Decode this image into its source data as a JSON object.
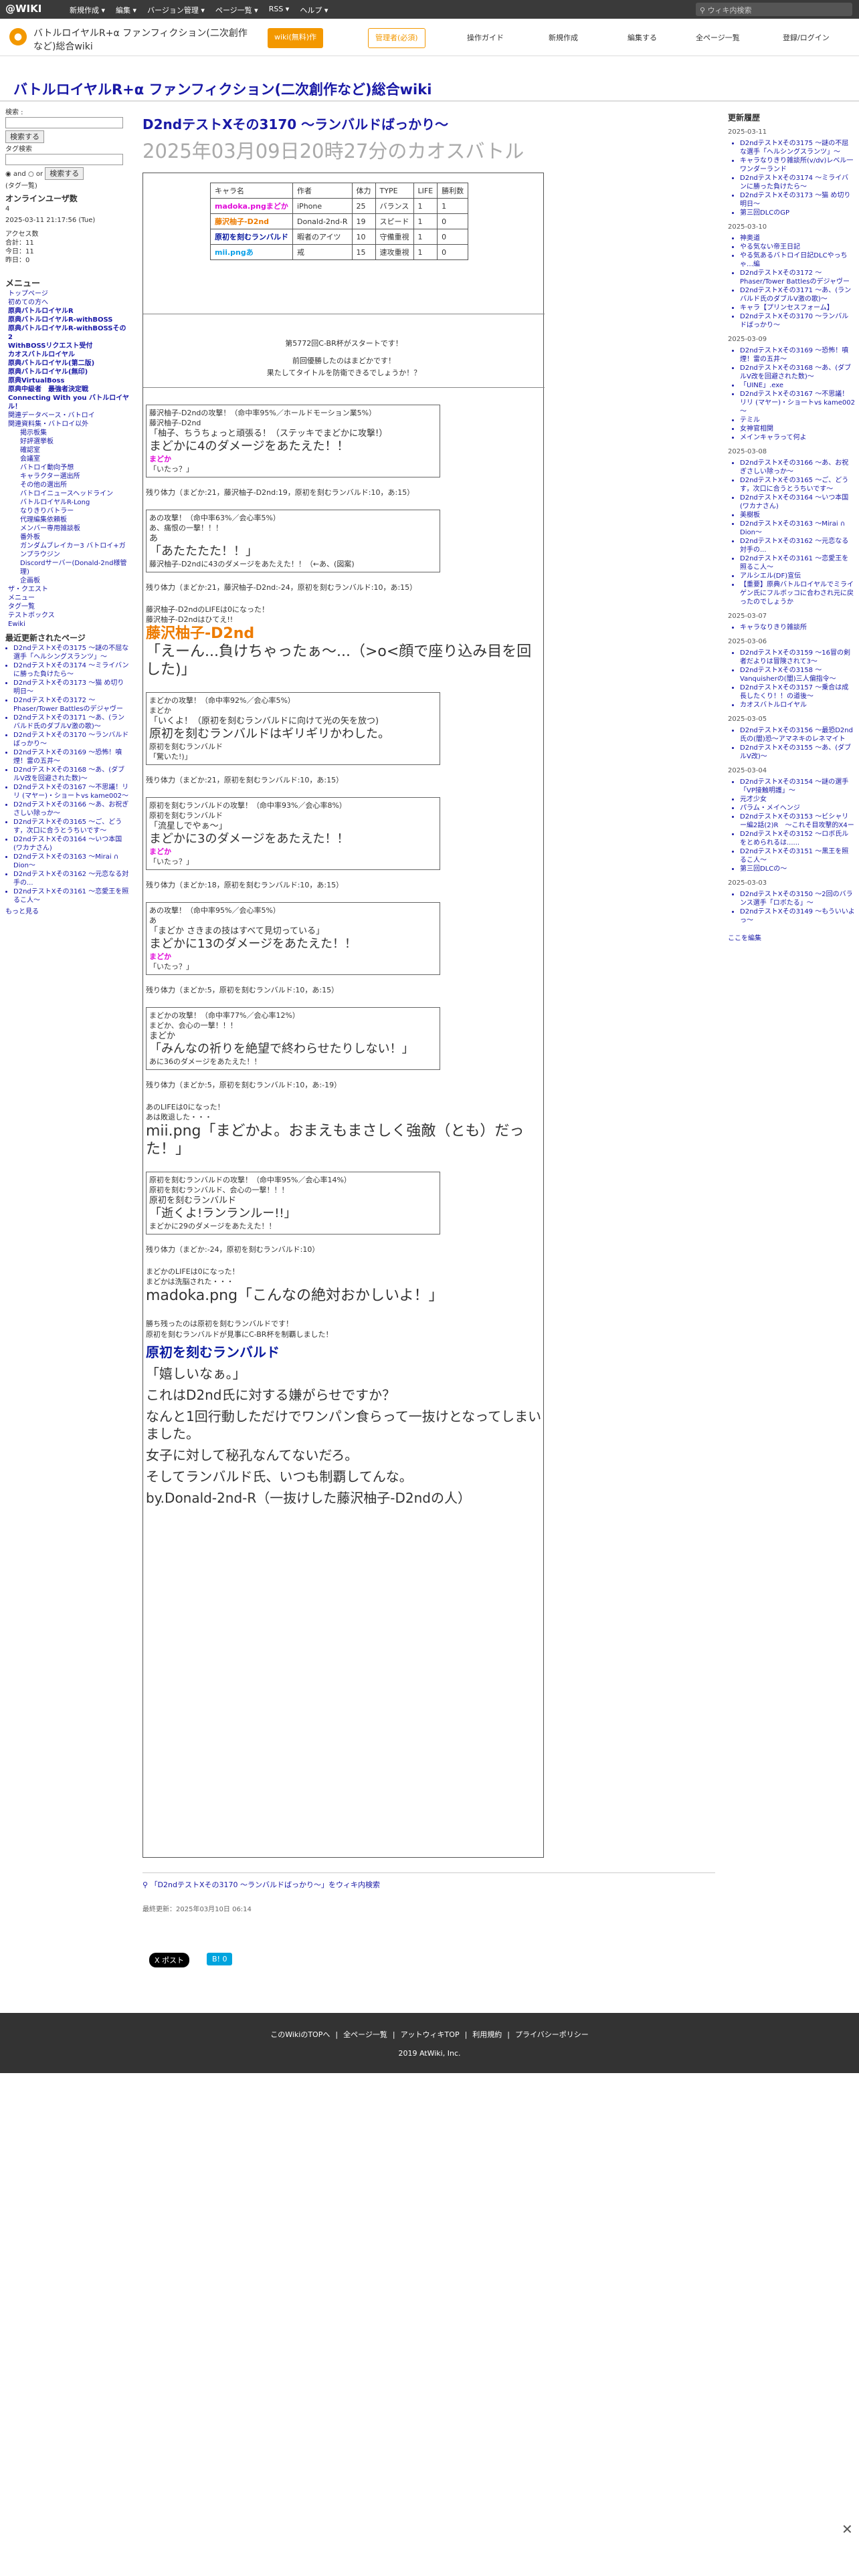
{
  "topbar": {
    "logo": "@WIKI",
    "menus": [
      "新規作成 ▾",
      "編集 ▾",
      "バージョン管理 ▾",
      "ページ一覧 ▾",
      "RSS ▾",
      "ヘルプ ▾"
    ],
    "search_placeholder": "ウィキ内検索"
  },
  "header": {
    "site_name": "バトルロイヤルR+α ファンフィクション(二次創作など)総合wiki",
    "wiki_btn": "wiki(無料)作",
    "rec_btn": "管理者(必須)",
    "links": [
      "操作ガイド",
      "新規作成",
      "編集する",
      "全ページ一覧",
      "登録/ログイン"
    ]
  },
  "wiki_title": "バトルロイヤルR+α ファンフィクション(二次創作など)総合wiki",
  "left": {
    "search_label": "検索 :",
    "search_btn": "検索する",
    "tag_label": "タグ検索",
    "and": "and",
    "or": "or",
    "tag_btn": "検索する",
    "tag_help": "(タグ一覧)",
    "online_title": "オンラインユーザ数",
    "online": "4",
    "datetime": "2025-03-11 21:17:56 (Tue)",
    "access_title": "アクセス数",
    "access": [
      "合計：11",
      "今日：11",
      "昨日：0"
    ],
    "menu_title": "メニュー",
    "menu": [
      "トップページ",
      "初めての方へ",
      "原典バトルロイヤルR",
      "原典バトルロイヤルR-withBOSS",
      "原典バトルロイヤルR-withBOSSその2",
      "WithBOSSリクエスト受付",
      "カオスバトルロイヤル",
      "原典バトルロイヤル(第二版)",
      "原典バトルロイヤル(無印)",
      "原典VirtualBoss",
      "原典中級者　最強者決定戦",
      "Connecting With you バトルロイヤル！",
      "関連データベース・バトロイ",
      "関連資料集・バトロイ以外",
      "掲示板集",
      "好評選挙板",
      "確認室",
      "会議室",
      "バトロイ動向予想",
      "キャラクター選出所",
      "その他の選出所",
      "バトロイニュースヘッドライン",
      "バトルロイヤルR-Long",
      "なりきりバトラー",
      "代理編集依頼板",
      "メンバー専用雑談板",
      "番外板",
      "ガンダムブレイカー3 バトロイ+ガンプラウジン",
      "Discordサーバー(Donald-2nd様管理)",
      "企画板",
      "ザ・クエスト",
      "メニュー",
      "タグ一覧",
      "テストボックス",
      "Ewiki"
    ],
    "recent_title": "最近更新されたページ",
    "recent": [
      "D2ndテストXその3175 ～謎の不屈な選手「ヘルシングスランツ」～",
      "D2ndテストXその3174 ～ミライバンに勝った負けたら～",
      "D2ndテストXその3173 ～猫 め切り明日～",
      "D2ndテストXその3172 ～Phaser/Tower Battlesのデジャヴー",
      "D2ndテストXその3171 ～あ、(ランバルド氏のダブルV激の歌)～",
      "D2ndテストXその3170 ～ランバルドばっかり～",
      "D2ndテストXその3169 ～恐怖！噴煙！雷の五井～",
      "D2ndテストXその3168 ～あ、(ダブルV改を回避された数)～",
      "D2ndテストXその3167 ～不思議！リリ (マヤー)・ショートvs kame002～",
      "D2ndテストXその3166 ～あ、お祝ぎさしい除っか～",
      "D2ndテストXその3165 ～ご、どうす，次口に合うとうちいです～",
      "D2ndテストXその3164 ～いつ本国(ワカナさん)",
      "D2ndテストXその3163 ～Mirai ∩ Dion～",
      "D2ndテストXその3162 ～元恋なる対手の...",
      "D2ndテストXその3161 ～恋愛王を照るこ人～"
    ],
    "more": "もっと見る"
  },
  "page": {
    "title": "D2ndテストXその3170 ～ランバルドばっかり～",
    "subtitle": "2025年03月09日20時27分のカオスバトル"
  },
  "table": {
    "headers": [
      "キャラ名",
      "作者",
      "体力",
      "TYPE",
      "LIFE",
      "勝利数"
    ],
    "rows": [
      [
        "madoka.pngまどか",
        "iPhone",
        "25",
        "バランス",
        "1",
        "1"
      ],
      [
        "藤沢柚子-D2nd",
        "Donald-2nd-R",
        "19",
        "スピード",
        "1",
        "0"
      ],
      [
        "原初を刻むランバルド",
        "暇者のアイツ",
        "10",
        "守備重視",
        "1",
        "0"
      ],
      [
        "mii.pngあ",
        "戒",
        "15",
        "速攻重視",
        "1",
        "0"
      ]
    ]
  },
  "intro": [
    "第5772回C-BR杯がスタートです！",
    "前回優勝したのはまどかです！",
    "果たしてタイトルを防衛できるでしょうか！？"
  ],
  "turns": [
    {
      "who": "藤沢柚子-D2nd",
      "desc": "の攻撃！（命中率95%／ホールドモーション業5%）",
      "lines": [
        "藤沢柚子-D2nd",
        "「柚子、ちうちょっと頑張る！（ステッキでまどかに攻撃!）",
        "まどかに4のダメージをあたえた！！"
      ],
      "target": "まどか",
      "reply": "「いたっ？」"
    },
    {
      "status": "残り体力（まどか:21，藤沢柚子-D2nd:19，原初を刻むランバルド:10，あ:15）"
    },
    {
      "who": "あ",
      "desc": "の攻撃！（命中率63%／会心率5%）",
      "lines": [
        "あ、痛恨の一撃！！！",
        "あ",
        "「あたたたた！！」",
        "藤沢柚子-D2ndに43のダメージをあたえた！！（←あ、(図案)"
      ]
    },
    {
      "status": "残り体力（まどか:21，藤沢柚子-D2nd:-24，原初を刻むランバルド:10，あ:15）"
    },
    {
      "defeat": [
        "藤沢柚子-D2ndのLIFEは0になった！",
        "藤沢柚子-D2ndはひてえ!!",
        "藤沢柚子-D2nd",
        "「えーん...負けちゃったぁ～...（>o<顔で座り込み目を回した)」"
      ]
    },
    {
      "who": "まどか",
      "desc": "の攻撃！（命中率92%／会心率5%）",
      "lines": [
        "まどか",
        "「いくよ！（原初を刻むランバルドに向けて光の矢を放つ)",
        "原初を刻むランバルドはギリギリかわした。",
        "原初を刻むランバルド",
        "「驚いた!)」"
      ]
    },
    {
      "status": "残り体力（まどか:21，原初を刻むランバルド:10，あ:15）"
    },
    {
      "who": "原初を刻むランバルド",
      "desc": "の攻撃！（命中率93%／会心率8%）",
      "lines": [
        "原初を刻むランバルド",
        "「流星しでやぁ～」",
        "まどかに3のダメージをあたえた！！"
      ],
      "target": "まどか",
      "reply": "「いたっ？」"
    },
    {
      "status": "残り体力（まどか:18，原初を刻むランバルド:10，あ:15）"
    },
    {
      "who": "あ",
      "desc": "の攻撃！（命中率95%／会心率5%）",
      "lines": [
        "あ",
        "「まどか さきまの技はすべて見切っている」",
        "まどかに13のダメージをあたえた！！"
      ],
      "target": "まどか",
      "reply": "「いたっ？」"
    },
    {
      "status": "残り体力（まどか:5，原初を刻むランバルド:10，あ:15）"
    },
    {
      "who": "まどか",
      "desc": "の攻撃！（命中率77%／会心率12%）",
      "lines": [
        "まどか、会心の一撃！！！",
        "まどか",
        "「みんなの祈りを絶望で終わらせたりしない！」",
        "あに36のダメージをあたえた！！"
      ]
    },
    {
      "status": "残り体力（まどか:5，原初を刻むランバルド:10，あ:-19）"
    },
    {
      "defeat": [
        "あのLIFEは0になった！",
        "あは敗退した・・・",
        "mii.png「まどかよ。おまえもまさしく強敵（とも）だった！」"
      ]
    },
    {
      "who": "原初を刻むランバルド",
      "desc": "の攻撃！（命中率95%／会心率14%）",
      "lines": [
        "原初を刻むランバルド、会心の一撃！！！",
        "原初を刻むランバルド",
        "「逝くよ!ランランルー!!」",
        "まどかに29のダメージをあたえた！！"
      ]
    },
    {
      "status": "残り体力（まどか:-24，原初を刻むランバルド:10）"
    },
    {
      "defeat": [
        "まどかのLIFEは0になった！",
        "まどかは洗脳された・・・",
        "madoka.png「こんなの絶対おかしいよ！」"
      ]
    }
  ],
  "ending": [
    "勝ち残ったのは原初を刻むランバルドです！",
    "原初を刻むランバルドが見事にC-BR杯を制覇しました！",
    "原初を刻むランバルド",
    "「嬉しいなぁ。」",
    "これはD2nd氏に対する嫌がらせですか？",
    "なんと1回行動しただけでワンパン食らって一抜けとなってしまいました。",
    "女子に対して秘孔なんてないだろ。",
    "そしてランバルド氏、いつも制覇してんな。",
    "by.Donald-2nd-R（一抜けした藤沢柚子-D2ndの人）"
  ],
  "search_link": "「D2ndテストXその3170 ～ランバルドばっかり～」をウィキ内検索",
  "updated": "最終更新：2025年03月10日 06:14",
  "share": [
    "X ポスト",
    "B! 0"
  ],
  "right": {
    "title": "更新履歴",
    "groups": [
      {
        "date": "2025-03-11",
        "items": [
          "D2ndテストXその3175 ～謎の不屈な選手「ヘルシングスランツ」～",
          "キャラなりきり雑談所(v/dv)レベル一ワンダーランド",
          "D2ndテストXその3174 ～ミライバンに勝った負けたら～",
          "D2ndテストXその3173 ～猫 め切り明日～",
          "第三回DLCのGP"
        ]
      },
      {
        "date": "2025-03-10",
        "items": [
          "神奥道",
          "やる気ない帝王日記",
          "やる気あるバトロイ日記DLCやっちゃ…編",
          "D2ndテストXその3172 ～Phaser/Tower Battlesのデジャヴー",
          "D2ndテストXその3171 ～あ、(ランバルド氏のダブルV激の歌)～",
          "キャラ【プリンセスフォーム】",
          "D2ndテストXその3170 ～ランバルドばっかり～"
        ]
      },
      {
        "date": "2025-03-09",
        "items": [
          "D2ndテストXその3169 ～恐怖！噴煙！雷の五井～",
          "D2ndテストXその3168 ～あ、(ダブルV改を回避された数)～",
          "「UINE」.exe",
          "D2ndテストXその3167 ～不思議！リリ (マヤー)・ショートvs kame002～",
          "テミル",
          "女神官相関",
          "メインキャラって何よ"
        ]
      },
      {
        "date": "2025-03-08",
        "items": [
          "D2ndテストXその3166 ～あ、お祝ぎさしい除っか～",
          "D2ndテストXその3165 ～ご、どうす，次口に合うとうちいです～",
          "D2ndテストXその3164 ～いつ本国(ワカナさん)",
          "美樹板",
          "D2ndテストXその3163 ～Mirai ∩ Dion～",
          "D2ndテストXその3162 ～元恋なる対手の...",
          "D2ndテストXその3161 ～恋愛王を照るこ人～",
          "アルシエル(DF)宣伝",
          "【重要】原典バトルロイヤルでミライゲン氏にフルボッコに合わされ元に戻ったのでしょうか"
        ]
      },
      {
        "date": "2025-03-07",
        "items": [
          "キャラなりきり雑談所"
        ]
      },
      {
        "date": "2025-03-06",
        "items": [
          "D2ndテストXその3159 ～16冒の剣者だよりは冒険されて3～",
          "D2ndテストXその3158 ～Vanquisherの(闇)三人偏指令～",
          "D2ndテストXその3157 ～乗合は成長したくり！！の道後～",
          "カオスバトルロイヤル"
        ]
      },
      {
        "date": "2025-03-05",
        "items": [
          "D2ndテストXその3156 ～最恐D2nd氏の(闇)恐～アマネキのレネマイト",
          "D2ndテストXその3155 ～あ、(ダブルV改)～"
        ]
      },
      {
        "date": "2025-03-04",
        "items": [
          "D2ndテストXその3154 ～謎の選手「VP接触明護」～",
          "元才少女",
          "パラム・メイヘンジ",
          "D2ndテストXその3153 ～ビシャリー編2話(2)R　～これそ目攻撃的X4ー",
          "D2ndテストXその3152 ～ロボ氏ルをとめられるは......",
          "D2ndテストXその3151 ～黒王を照るこ人～",
          "第三回DLCの～"
        ]
      },
      {
        "date": "2025-03-03",
        "items": [
          "D2ndテストXその3150 ～2回のバランス選手「ロボたる」～",
          "D2ndテストXその3149 ～もういいよっ～"
        ]
      }
    ],
    "more": "ここを編集"
  },
  "footer": {
    "links": [
      "このWikiのTOPへ",
      "|",
      "全ページ一覧",
      "|",
      "アットウィキTOP",
      "|",
      "利用規約",
      "|",
      "プライバシーポリシー"
    ],
    "copy": "2019 AtWiki, Inc."
  }
}
